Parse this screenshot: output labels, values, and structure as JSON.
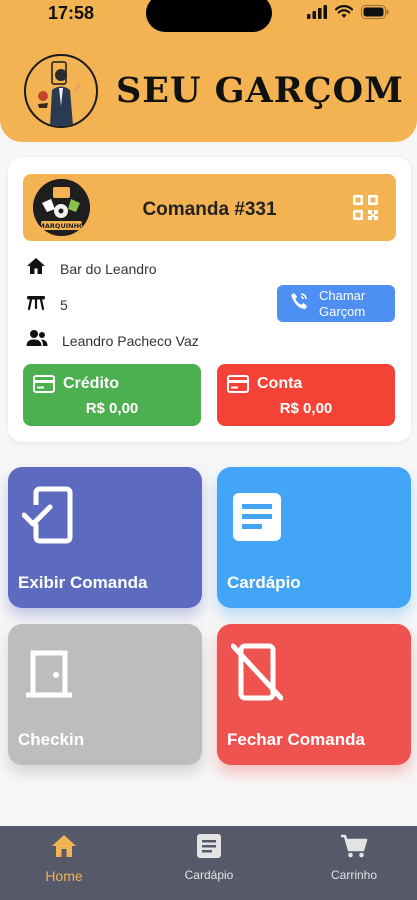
{
  "status_bar": {
    "time": "17:58"
  },
  "header": {
    "brand": "SEU GARÇOM"
  },
  "comanda": {
    "title": "Comanda #331",
    "bar_logo_text": "MARQUINHO"
  },
  "info": {
    "place": "Bar do Leandro",
    "table": "5",
    "customer": "Leandro Pacheco Vaz"
  },
  "call_button": {
    "line1": "Chamar",
    "line2": "Garçom"
  },
  "credito": {
    "title": "Crédito",
    "value": "R$ 0,00"
  },
  "conta": {
    "title": "Conta",
    "value": "R$ 0,00"
  },
  "tiles": {
    "exibir": "Exibir Comanda",
    "cardapio": "Cardápio",
    "checkin": "Checkin",
    "fechar": "Fechar Comanda"
  },
  "nav": {
    "home": "Home",
    "cardapio": "Cardápio",
    "carrinho": "Carrinho"
  },
  "colors": {
    "brand": "#f3b353",
    "credito": "#4caf50",
    "conta": "#f44336",
    "exibir": "#5c6bc0",
    "cardapio": "#42a5f5",
    "checkin": "#bdbdbd",
    "fechar": "#ef5350",
    "nav_bg": "#56596a"
  }
}
